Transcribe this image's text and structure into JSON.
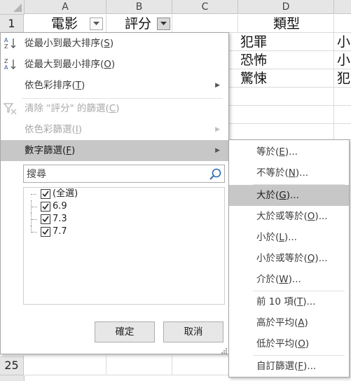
{
  "sheet": {
    "columns": [
      "A",
      "B",
      "C",
      "D"
    ],
    "rows": [
      "1",
      "25"
    ],
    "headers": {
      "A1": "電影",
      "B1": "評分",
      "D1": "類型"
    },
    "col_d_values": [
      "犯罪",
      "恐怖",
      "驚悚"
    ],
    "col_e_partial": [
      "小",
      "小",
      "犯"
    ]
  },
  "filter_menu": {
    "items": [
      {
        "label": "從最小到最大排序(",
        "key": "S",
        "tail": ")",
        "icon": "sort-ascending-icon",
        "disabled": false
      },
      {
        "label": "從最大到最小排序(",
        "key": "O",
        "tail": ")",
        "icon": "sort-descending-icon",
        "disabled": false
      },
      {
        "label": "依色彩排序(",
        "key": "T",
        "tail": ")",
        "disabled": false
      },
      {
        "label": "清除 \"評分\" 的篩選(",
        "key": "C",
        "tail": ")",
        "icon": "clear-filter-icon",
        "disabled": true
      },
      {
        "label": "依色彩篩選(",
        "key": "I",
        "tail": ")",
        "disabled": true
      },
      {
        "label": "數字篩選(",
        "key": "F",
        "tail": ")",
        "disabled": false
      }
    ],
    "search_placeholder": "搜尋",
    "values": [
      {
        "label": "(全選)",
        "checked": true
      },
      {
        "label": "6.9",
        "checked": true
      },
      {
        "label": "7.3",
        "checked": true
      },
      {
        "label": "7.7",
        "checked": true
      }
    ],
    "ok_label": "確定",
    "cancel_label": "取消"
  },
  "number_filter_submenu": {
    "items": [
      {
        "label": "等於(",
        "key": "E",
        "tail": ")..."
      },
      {
        "label": "不等於(",
        "key": "N",
        "tail": ")..."
      },
      {
        "label": "大於(",
        "key": "G",
        "tail": ")..."
      },
      {
        "label": "大於或等於(",
        "key": "O",
        "tail": ")..."
      },
      {
        "label": "小於(",
        "key": "L",
        "tail": ")..."
      },
      {
        "label": "小於或等於(",
        "key": "Q",
        "tail": ")..."
      },
      {
        "label": "介於(",
        "key": "W",
        "tail": ")..."
      },
      {
        "label": "前 10 項(",
        "key": "T",
        "tail": ")..."
      },
      {
        "label": "高於平均(",
        "key": "A",
        "tail": ")"
      },
      {
        "label": "低於平均(",
        "key": "O",
        "tail": ")"
      },
      {
        "label": "自訂篩選(",
        "key": "F",
        "tail": ")..."
      }
    ]
  },
  "colors": {
    "highlight": "#c7c7c7",
    "header_bg": "#e6e6e6",
    "disabled_text": "#a8a8a8"
  }
}
